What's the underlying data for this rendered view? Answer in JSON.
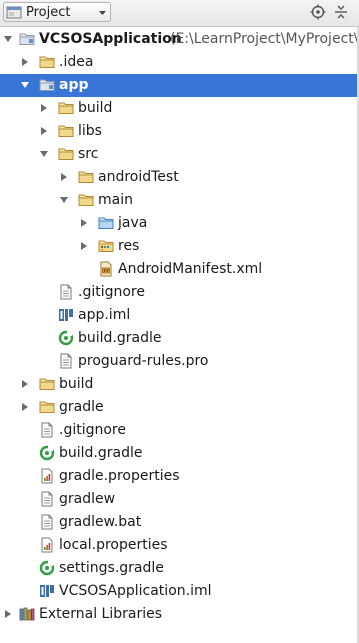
{
  "header": {
    "view_label": "Project",
    "icons": [
      "project-view-icon",
      "dropdown-arrow-icon",
      "locate-icon",
      "collapse-all-icon"
    ]
  },
  "colors": {
    "selection": "#3875d7",
    "folder": "#c7a14c",
    "folder_blue": "#5b9bd5",
    "gradle_green": "#2f9e41",
    "text": "#1a1a1a"
  },
  "tree": {
    "root": {
      "name": "VCSOSApplication",
      "path": "(E:\\LearnProject\\MyProject\\A"
    },
    "idea": ".idea",
    "app": "app",
    "app_build": "build",
    "app_libs": "libs",
    "app_src": "src",
    "android_test": "androidTest",
    "main": "main",
    "java": "java",
    "res": "res",
    "manifest": "AndroidManifest.xml",
    "app_gitignore": ".gitignore",
    "app_iml": "app.iml",
    "app_build_gradle": "build.gradle",
    "proguard": "proguard-rules.pro",
    "build": "build",
    "gradle": "gradle",
    "gitignore": ".gitignore",
    "build_gradle": "build.gradle",
    "gradle_properties": "gradle.properties",
    "gradlew": "gradlew",
    "gradlew_bat": "gradlew.bat",
    "local_properties": "local.properties",
    "settings_gradle": "settings.gradle",
    "project_iml": "VCSOSApplication.iml",
    "external_libraries": "External Libraries"
  }
}
